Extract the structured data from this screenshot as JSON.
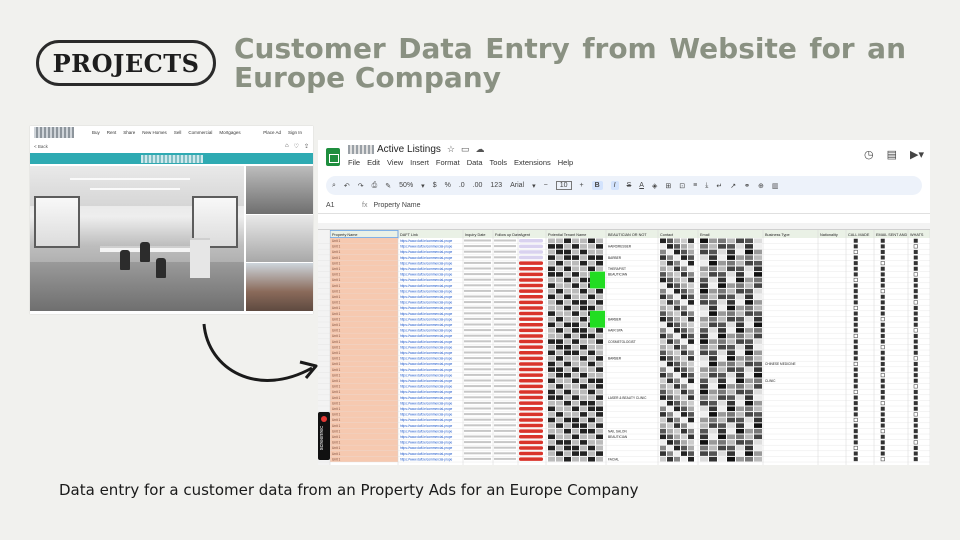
{
  "header": {
    "badge": "PROJECTS",
    "title": "Customer Data Entry from Website for an Europe Company"
  },
  "website": {
    "nav": [
      "Buy",
      "Rent",
      "Share",
      "New Homes",
      "Sell",
      "Commercial",
      "Mortgages"
    ],
    "nav_right": [
      "Place Ad",
      "Sign In"
    ],
    "back": "< Back"
  },
  "sheet": {
    "doc_title": "Active Listings",
    "menu": [
      "File",
      "Edit",
      "View",
      "Insert",
      "Format",
      "Data",
      "Tools",
      "Extensions",
      "Help"
    ],
    "zoom": "50%",
    "font": "Arial",
    "font_size": "10",
    "cell_ref": "A1",
    "formula": "Property Name",
    "columns": [
      "Property Name",
      "DAFT Link",
      "Inquiry Date",
      "Follow up Date",
      "Agent",
      "Potential Tenant Name",
      "BEAUTICIAN OR NOT",
      "Contact",
      "Email",
      "Business Type",
      "Nationality",
      "CALL MADE",
      "EMAIL SENT AND",
      "WHATS"
    ],
    "row_name": "Unit 1",
    "link_text": "https://www.daft.ie/commercial-prope",
    "agent": "Mark C",
    "status_tag": "Private",
    "business_notes": [
      {
        "row": 1,
        "text": "HAIRDRESSER"
      },
      {
        "row": 3,
        "text": "BARBER"
      },
      {
        "row": 5,
        "text": "THERAPIST"
      },
      {
        "row": 6,
        "text": "BEAUTICIAN"
      },
      {
        "row": 14,
        "text": "BARBER"
      },
      {
        "row": 16,
        "text": "HAIR SPA"
      },
      {
        "row": 18,
        "text": "COSMETOLOGIST"
      },
      {
        "row": 21,
        "text": "BARBER"
      },
      {
        "row": 28,
        "text": "LASER & BEAUTY CLINIC"
      },
      {
        "row": 34,
        "text": "NAIL SALON"
      },
      {
        "row": 35,
        "text": "BEAUTICIAN"
      },
      {
        "row": 39,
        "text": "FACIAL"
      }
    ],
    "type_notes": [
      {
        "row": 22,
        "text": "CHINESE MEDICINE"
      },
      {
        "row": 25,
        "text": "CLINIC"
      }
    ]
  },
  "recorder": "screenrec",
  "caption": "Data entry for a customer data from an Property Ads for an Europe Company",
  "colors": {
    "title": "#8a9182",
    "teal": "#2eaab2",
    "peach": "#f6c9b0",
    "green": "#22dd22",
    "red": "#d9342b"
  }
}
